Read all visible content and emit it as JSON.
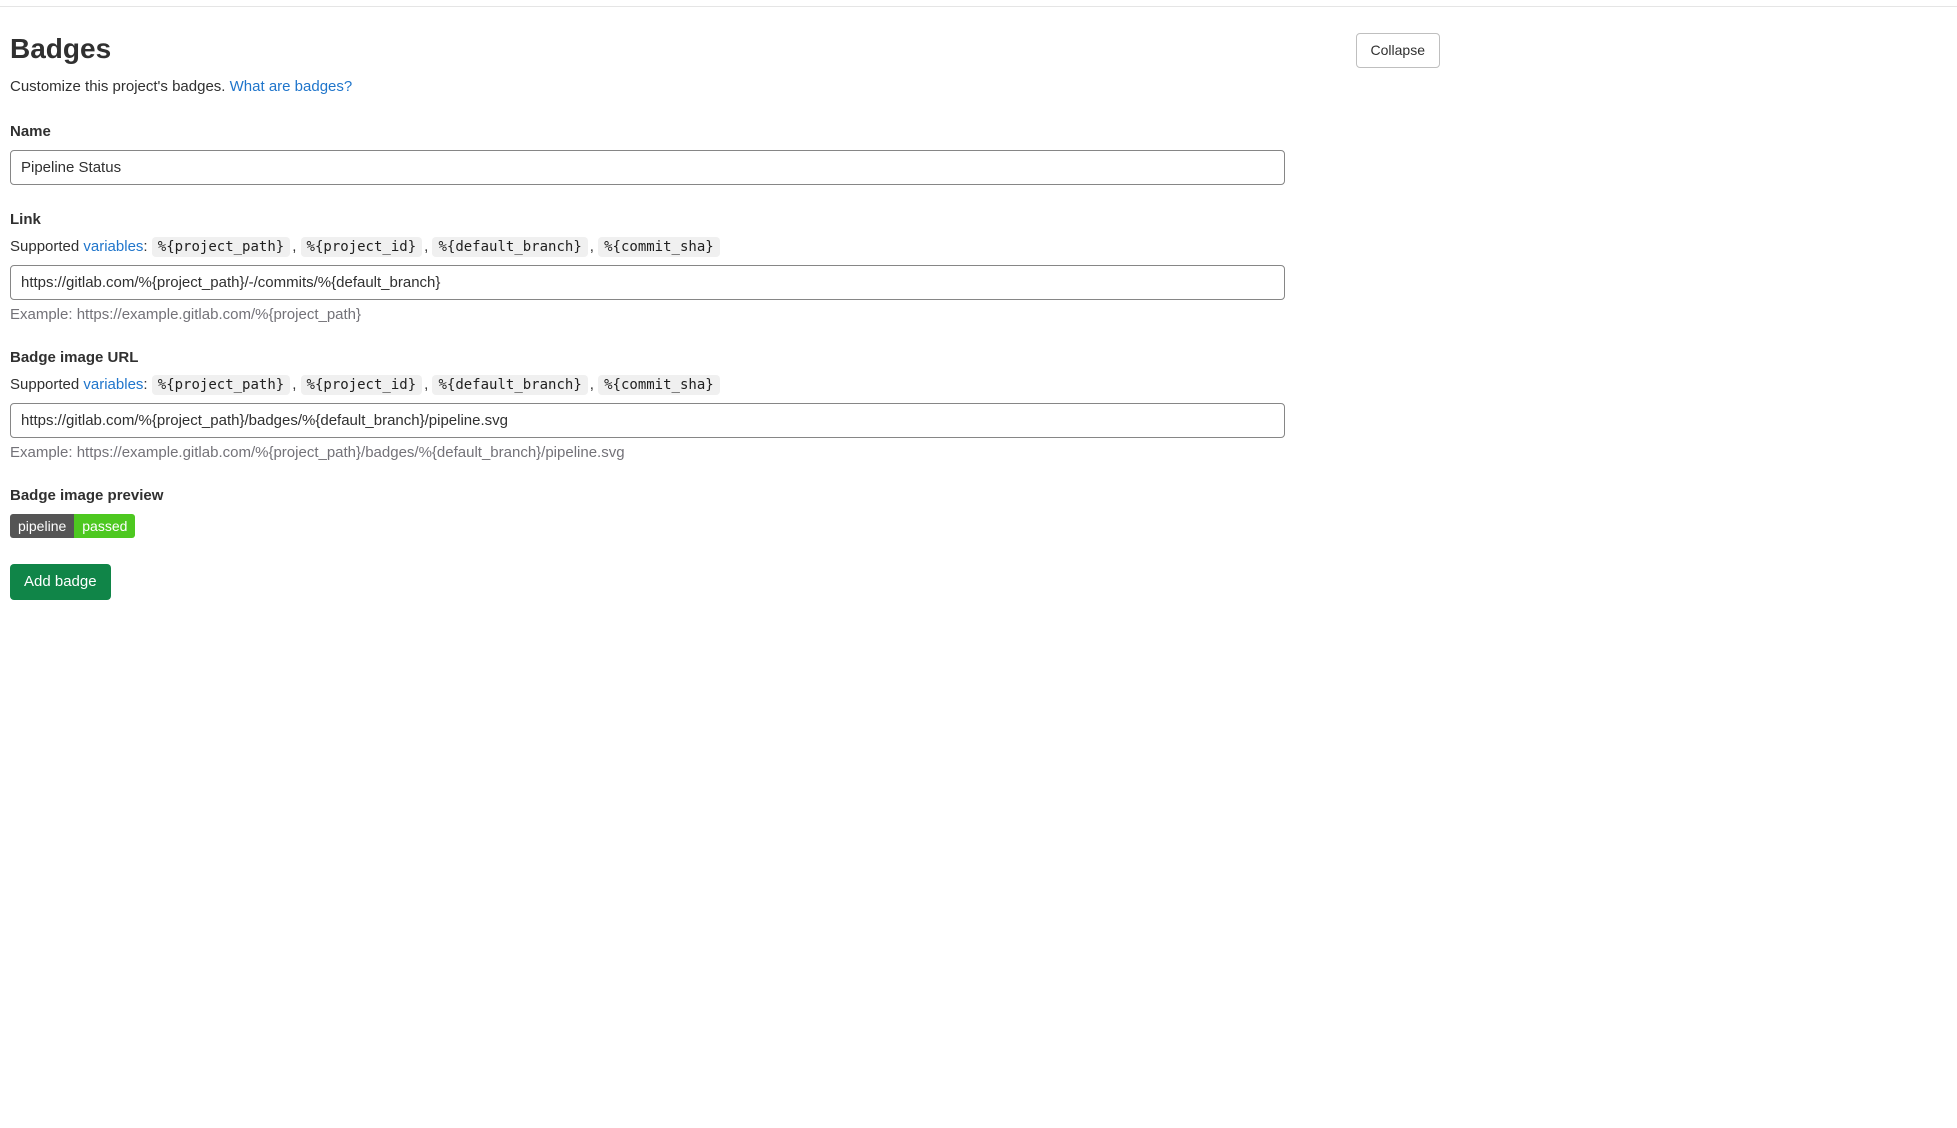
{
  "header": {
    "title": "Badges",
    "collapse_label": "Collapse"
  },
  "description": {
    "text": "Customize this project's badges. ",
    "link_text": "What are badges?"
  },
  "fields": {
    "name": {
      "label": "Name",
      "value": "Pipeline Status"
    },
    "link": {
      "label": "Link",
      "supported_text": "Supported ",
      "variables_link": "variables",
      "colon": ": ",
      "vars": [
        "%{project_path}",
        "%{project_id}",
        "%{default_branch}",
        "%{commit_sha}"
      ],
      "value": "https://gitlab.com/%{project_path}/-/commits/%{default_branch}",
      "example": "Example: https://example.gitlab.com/%{project_path}"
    },
    "image_url": {
      "label": "Badge image URL",
      "supported_text": "Supported ",
      "variables_link": "variables",
      "colon": ": ",
      "vars": [
        "%{project_path}",
        "%{project_id}",
        "%{default_branch}",
        "%{commit_sha}"
      ],
      "value": "https://gitlab.com/%{project_path}/badges/%{default_branch}/pipeline.svg",
      "example": "Example: https://example.gitlab.com/%{project_path}/badges/%{default_branch}/pipeline.svg"
    },
    "preview": {
      "label": "Badge image preview",
      "left": "pipeline",
      "right": "passed"
    }
  },
  "actions": {
    "add_label": "Add badge"
  },
  "separator": ", "
}
